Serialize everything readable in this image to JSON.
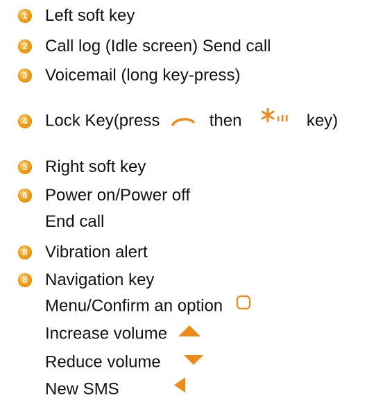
{
  "colors": {
    "accent": "#f08a17",
    "bullet": "#f4a21a",
    "text": "#111111"
  },
  "items": [
    {
      "number": "1",
      "label": "Left soft key"
    },
    {
      "number": "2",
      "label": "Call log (Idle screen) Send call"
    },
    {
      "number": "3",
      "label": "Voicemail (long key-press)"
    },
    {
      "number": "4",
      "label_before": "Lock Key(press",
      "label_middle": "then",
      "label_after": "key)"
    },
    {
      "number": "5",
      "label": "Right soft key"
    },
    {
      "number": "6",
      "label": "Power on/Power off"
    },
    {
      "label": "End call"
    },
    {
      "number": "8",
      "label": "Vibration alert"
    },
    {
      "number": "8",
      "label": "Navigation key"
    },
    {
      "label": "Menu/Confirm an option"
    },
    {
      "label": "Increase volume"
    },
    {
      "label": "Reduce volume"
    },
    {
      "label": "New SMS"
    }
  ],
  "icons": {
    "send_key": "send-key-icon",
    "star_key": "star-key-icon",
    "confirm_key": "confirm-square-icon",
    "up_key": "up-arrow-icon",
    "down_key": "down-arrow-icon",
    "left_key": "left-arrow-icon"
  }
}
